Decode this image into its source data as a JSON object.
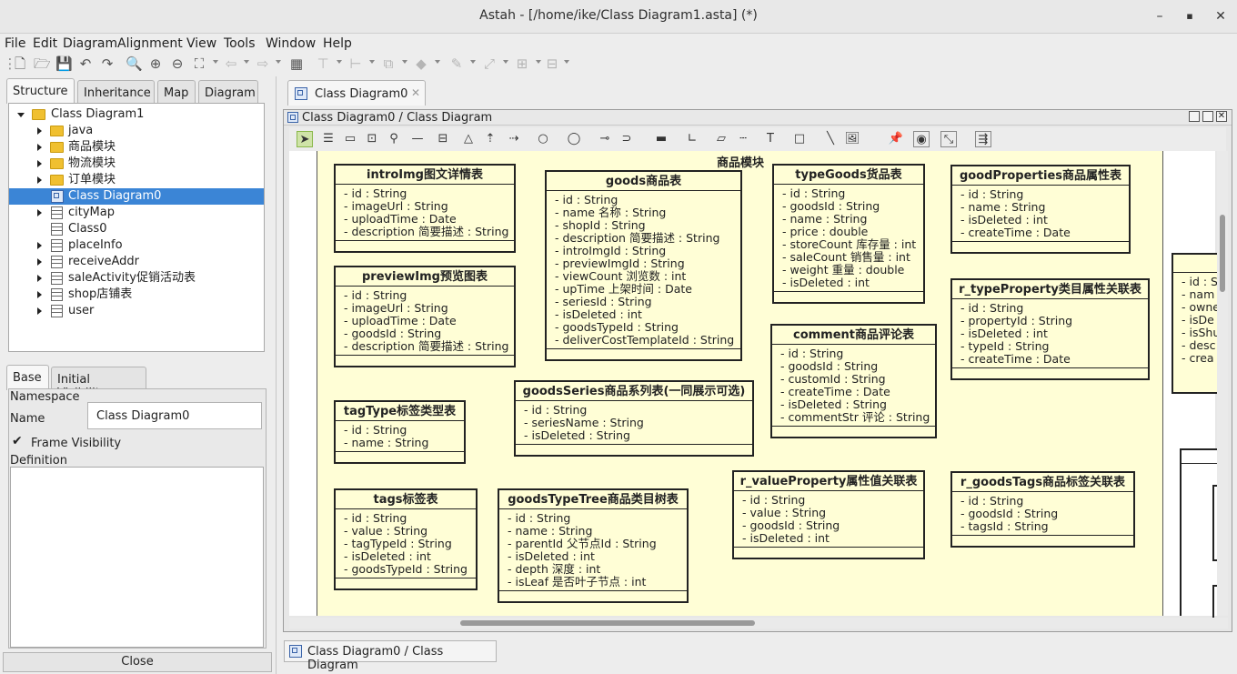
{
  "window": {
    "title": "Astah - [/home/ike/Class Diagram1.asta] (*)",
    "minimize": "–",
    "maximize": "▪",
    "close": "✕"
  },
  "menu": [
    "File",
    "Edit",
    "Diagram",
    "Alignment",
    "View",
    "Tools",
    "Window",
    "Help"
  ],
  "left_tabs": [
    "Structure",
    "Inheritance",
    "Map",
    "Diagram"
  ],
  "tree": [
    {
      "label": "Class Diagram1",
      "type": "root",
      "level": 0,
      "twisty": "open"
    },
    {
      "label": "java",
      "type": "folder",
      "level": 1,
      "twisty": "closed"
    },
    {
      "label": "商品模块",
      "type": "folder",
      "level": 1,
      "twisty": "closed"
    },
    {
      "label": "物流模块",
      "type": "folder",
      "level": 1,
      "twisty": "closed"
    },
    {
      "label": "订单模块",
      "type": "folder",
      "level": 1,
      "twisty": "closed"
    },
    {
      "label": "Class Diagram0",
      "type": "diagram",
      "level": 1,
      "twisty": "none",
      "selected": true
    },
    {
      "label": "cityMap",
      "type": "class",
      "level": 1,
      "twisty": "closed"
    },
    {
      "label": "Class0",
      "type": "class",
      "level": 1,
      "twisty": "none"
    },
    {
      "label": "placeInfo",
      "type": "class",
      "level": 1,
      "twisty": "closed"
    },
    {
      "label": "receiveAddr",
      "type": "class",
      "level": 1,
      "twisty": "closed"
    },
    {
      "label": "saleActivity促销活动表",
      "type": "class",
      "level": 1,
      "twisty": "closed"
    },
    {
      "label": "shop店铺表",
      "type": "class",
      "level": 1,
      "twisty": "closed"
    },
    {
      "label": "user",
      "type": "class",
      "level": 1,
      "twisty": "closed"
    }
  ],
  "prop_tabs": [
    "Base",
    "Initial Visibility"
  ],
  "props": {
    "namespace_label": "Namespace",
    "name_label": "Name",
    "name_value": "Class Diagram0",
    "frame_visibility": "Frame Visibility",
    "definition_label": "Definition",
    "close": "Close"
  },
  "editor": {
    "tab_label": "Class Diagram0",
    "tab_close": "✕",
    "frame_title": "Class Diagram0 / Class Diagram",
    "package_name": "商品模块",
    "status_tab": "Class Diagram0 / Class Diagram"
  },
  "classes": [
    {
      "name": "introImg图文详情表",
      "attrs": [
        "- id : String",
        "- imageUrl : String",
        "- uploadTime : Date",
        "- description 简要描述 : String"
      ]
    },
    {
      "name": "previewImg预览图表",
      "attrs": [
        "- id : String",
        "- imageUrl : String",
        "- uploadTime : Date",
        "- goodsId : String",
        "- description 简要描述 : String"
      ]
    },
    {
      "name": "tagType标签类型表",
      "attrs": [
        "- id : String",
        "- name : String"
      ]
    },
    {
      "name": "tags标签表",
      "attrs": [
        "- id : String",
        "- value : String",
        "- tagTypeId : String",
        "- isDeleted : int",
        "- goodsTypeId : String"
      ]
    },
    {
      "name": "goods商品表",
      "attrs": [
        "- id : String",
        "- name 名称 : String",
        "- shopId : String",
        "- description 简要描述 : String",
        "- introImgId : String",
        "- previewImgId : String",
        "- viewCount 浏览数 : int",
        "- upTime 上架时间 : Date",
        "- seriesId : String",
        "- isDeleted : int",
        "- goodsTypeId : String",
        "- deliverCostTemplateId : String"
      ]
    },
    {
      "name": "goodsSeries商品系列表(一同展示可选)",
      "attrs": [
        "- id : String",
        "- seriesName : String",
        "- isDeleted : String"
      ]
    },
    {
      "name": "goodsTypeTree商品类目树表",
      "attrs": [
        "- id : String",
        "- name : String",
        "- parentId 父节点Id : String",
        "- isDeleted : int",
        "- depth 深度 : int",
        "- isLeaf 是否叶子节点 : int"
      ]
    },
    {
      "name": "typeGoods货品表",
      "attrs": [
        "- id : String",
        "- goodsId : String",
        "- name : String",
        "- price : double",
        "- storeCount 库存量 : int",
        "- saleCount 销售量 : int",
        "- weight 重量 : double",
        "- isDeleted : int"
      ]
    },
    {
      "name": "comment商品评论表",
      "attrs": [
        "- id : String",
        "- goodsId : String",
        "- customId : String",
        "- createTime : Date",
        "- isDeleted : String",
        "- commentStr 评论 : String"
      ]
    },
    {
      "name": "r_valueProperty属性值关联表",
      "attrs": [
        "- id : String",
        "- value : String",
        "- goodsId : String",
        "- isDeleted : int"
      ]
    },
    {
      "name": "goodProperties商品属性表",
      "attrs": [
        "- id : String",
        "- name : String",
        "- isDeleted : int",
        "- createTime : Date"
      ]
    },
    {
      "name": "r_typeProperty类目属性关联表",
      "attrs": [
        "- id : String",
        "- propertyId : String",
        "- isDeleted : int",
        "- typeId : String",
        "- createTime : Date"
      ]
    },
    {
      "name": "r_goodsTags商品标签关联表",
      "attrs": [
        "- id : String",
        "- goodsId : String",
        "- tagsId : String"
      ]
    }
  ],
  "partial_class": {
    "attrs": [
      "- id : S",
      "- nam",
      "- owne",
      "- isDe",
      "- isShu",
      "- desc",
      "- crea"
    ]
  }
}
